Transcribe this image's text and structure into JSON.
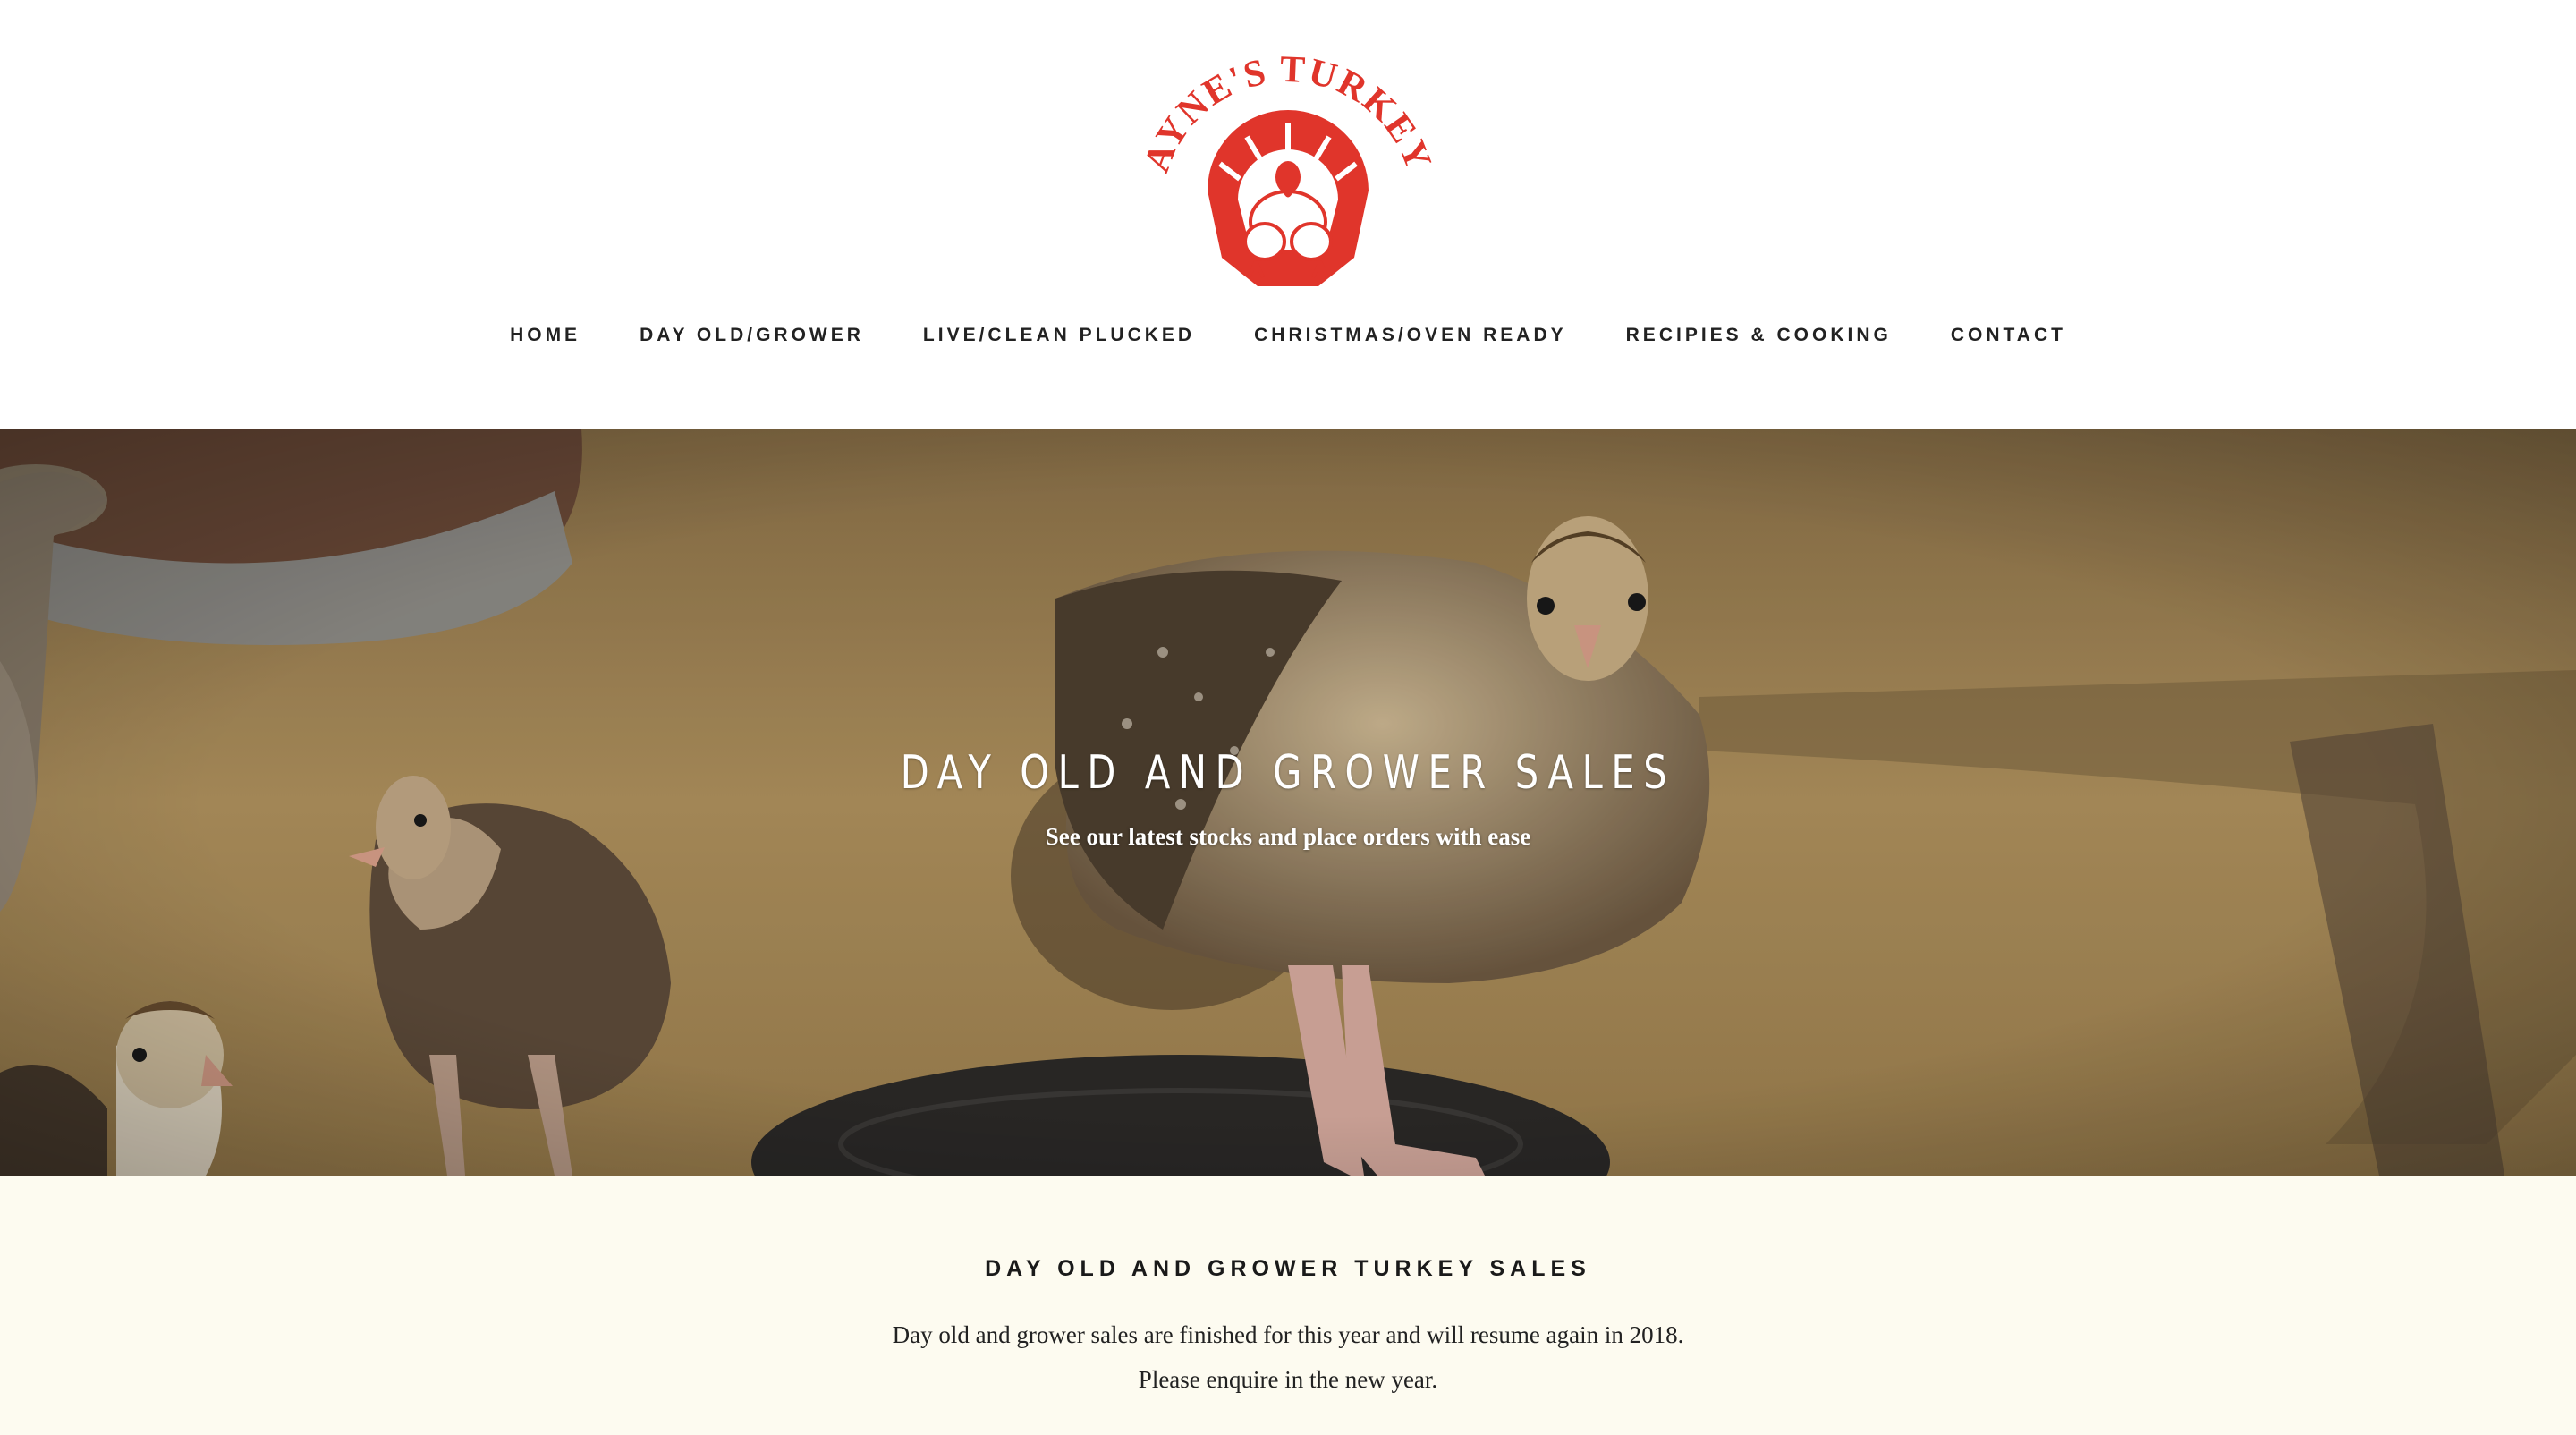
{
  "brand": {
    "logo_text": "PAYNE'S TURKEYS",
    "logo_color": "#e0352b"
  },
  "nav": {
    "items": [
      {
        "label": "HOME"
      },
      {
        "label": "DAY OLD/GROWER"
      },
      {
        "label": "LIVE/CLEAN PLUCKED"
      },
      {
        "label": "CHRISTMAS/OVEN READY"
      },
      {
        "label": "RECIPIES & COOKING"
      },
      {
        "label": "CONTACT"
      }
    ]
  },
  "hero": {
    "title": "DAY OLD AND GROWER SALES",
    "subtitle": "See our latest stocks and place orders with ease"
  },
  "content": {
    "heading": "DAY OLD AND GROWER TURKEY SALES",
    "paragraphs": [
      "Day old and grower sales are finished for this year and will resume again in 2018.",
      "Please enquire in the new year."
    ]
  },
  "colors": {
    "content_bg": "#fdfbf0",
    "text": "#1e1e1e"
  }
}
